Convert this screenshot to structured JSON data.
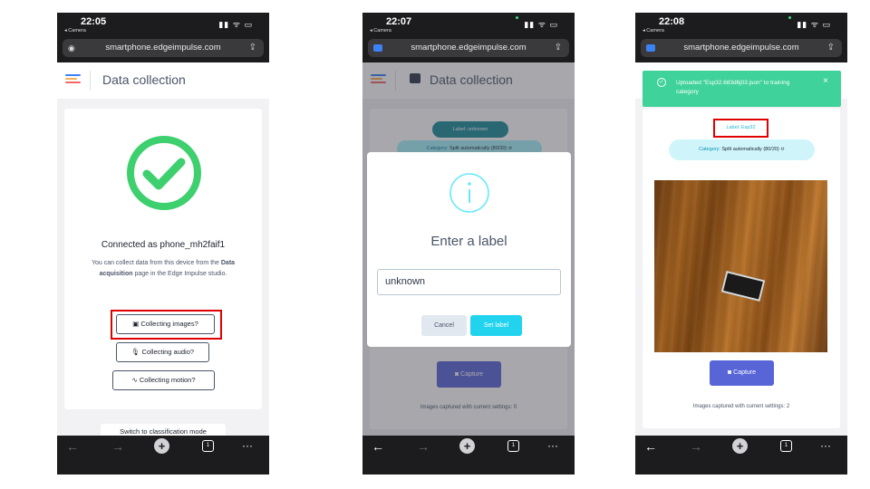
{
  "url": "smartphone.edgeimpulse.com",
  "back_app": "◂ Camera",
  "signal": "▮▮ ᯤ ▭",
  "icons": [
    "camera-icon",
    "share-icon",
    "checkmark-icon",
    "info-icon",
    "microphone-icon",
    "wave-icon",
    "check-circle-icon",
    "close-icon",
    "back-icon",
    "forward-icon",
    "plus-icon",
    "tabs-icon",
    "more-icon"
  ],
  "colors": {
    "teal": "#1a8a98",
    "cyan": "#22d3ee",
    "green": "#3ecf6e",
    "indigo": "#5865d6",
    "toast": "#3fd29a",
    "highlight": "#e00000"
  },
  "nav": {
    "back": "←",
    "forward": "→",
    "plus": "+",
    "tabs": "1",
    "more": "···"
  },
  "phone1": {
    "time": "22:05",
    "title": "Data collection",
    "connected": "Connected as phone_mh2faif1",
    "desc_prefix": "You can collect data from this device from the",
    "desc_bold": "Data acquisition",
    "desc_suffix": "page in the Edge Impulse studio.",
    "btn_images": "Collecting images?",
    "btn_audio": "Collecting audio?",
    "btn_motion": "Collecting motion?",
    "switch": "Switch to classification mode"
  },
  "phone2": {
    "time": "22:07",
    "title": "Data collection",
    "label_pill": "Label: unknown",
    "category_key": "Category:",
    "category_val": "Split automatically (80/20) ≎",
    "dialog_title": "Enter a label",
    "input_value": "unknown",
    "cancel": "Cancel",
    "set_label": "Set label",
    "capture": "Capture",
    "captured": "Images captured with current settings: 0"
  },
  "phone3": {
    "time": "22:08",
    "toast": "Uploaded \"Esp32.683d6j03.json\" to training category",
    "toast_close": "×",
    "label_pill": "Label: Esp32",
    "category_key": "Category:",
    "category_val": "Split automatically (80/20) ≎",
    "capture": "Capture",
    "captured": "Images captured with current settings: 2"
  }
}
